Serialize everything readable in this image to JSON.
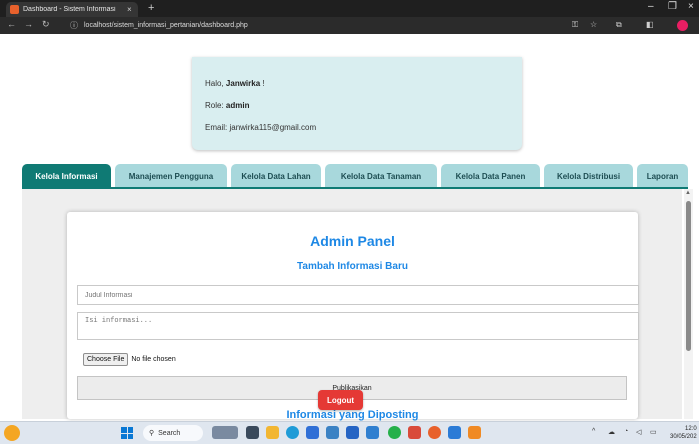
{
  "browser": {
    "tab_title": "Dashboard - Sistem Informasi",
    "tab_close": "×",
    "new_tab": "+",
    "url": "localhost/sistem_informasi_pertanian/dashboard.php",
    "window_controls": [
      "–",
      "❐",
      "×"
    ]
  },
  "user": {
    "greeting": "Halo,",
    "name": "Janwirka",
    "greeting_suffix": "!",
    "role_label": "Role:",
    "role": "admin",
    "email_label": "Email:",
    "email": "janwirka115@gmail.com"
  },
  "nav_tabs": [
    {
      "label": "Kelola Informasi",
      "active": true
    },
    {
      "label": "Manajemen Pengguna",
      "active": false
    },
    {
      "label": "Kelola Data Lahan",
      "active": false
    },
    {
      "label": "Kelola Data Tanaman",
      "active": false
    },
    {
      "label": "Kelola Data Panen",
      "active": false
    },
    {
      "label": "Kelola Distribusi",
      "active": false
    },
    {
      "label": "Laporan",
      "active": false
    }
  ],
  "panel": {
    "title": "Admin Panel",
    "subtitle": "Tambah Informasi Baru",
    "title_placeholder": "Judul Informasi",
    "body_placeholder": "Isi informasi...",
    "choose_file": "Choose File",
    "file_status": "No file chosen",
    "submit": "Publikasikan",
    "posted_title": "Informasi yang Diposting"
  },
  "logout": "Logout",
  "taskbar": {
    "search": "Search",
    "time": "12:0",
    "date": "30/05/202"
  },
  "colors": {
    "accent": "#0f7a74",
    "tab_bg": "#a8d8dc",
    "heading": "#1e88e5",
    "logout": "#e53935",
    "card_bg": "#d9eef0"
  }
}
